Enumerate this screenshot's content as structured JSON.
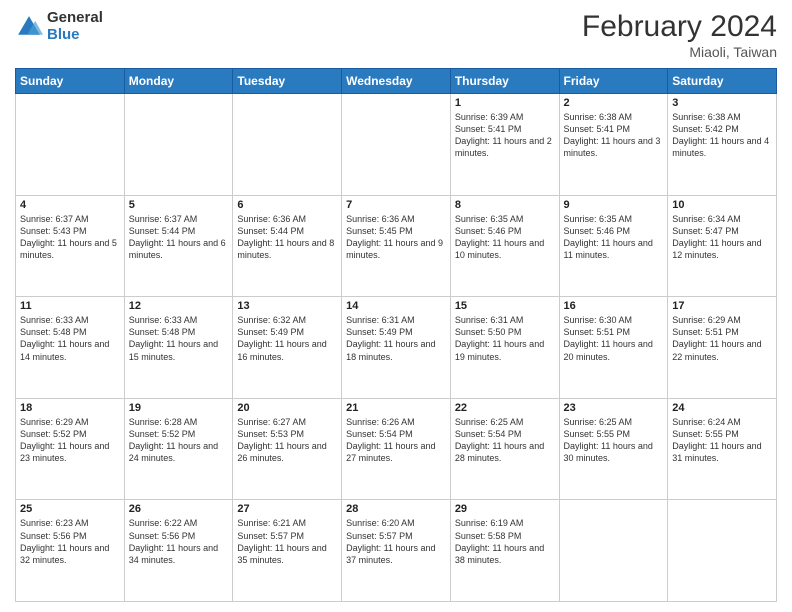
{
  "header": {
    "logo_line1": "General",
    "logo_line2": "Blue",
    "month_year": "February 2024",
    "location": "Miaoli, Taiwan"
  },
  "days_of_week": [
    "Sunday",
    "Monday",
    "Tuesday",
    "Wednesday",
    "Thursday",
    "Friday",
    "Saturday"
  ],
  "weeks": [
    [
      {
        "day": "",
        "info": ""
      },
      {
        "day": "",
        "info": ""
      },
      {
        "day": "",
        "info": ""
      },
      {
        "day": "",
        "info": ""
      },
      {
        "day": "1",
        "info": "Sunrise: 6:39 AM\nSunset: 5:41 PM\nDaylight: 11 hours and 2 minutes."
      },
      {
        "day": "2",
        "info": "Sunrise: 6:38 AM\nSunset: 5:41 PM\nDaylight: 11 hours and 3 minutes."
      },
      {
        "day": "3",
        "info": "Sunrise: 6:38 AM\nSunset: 5:42 PM\nDaylight: 11 hours and 4 minutes."
      }
    ],
    [
      {
        "day": "4",
        "info": "Sunrise: 6:37 AM\nSunset: 5:43 PM\nDaylight: 11 hours and 5 minutes."
      },
      {
        "day": "5",
        "info": "Sunrise: 6:37 AM\nSunset: 5:44 PM\nDaylight: 11 hours and 6 minutes."
      },
      {
        "day": "6",
        "info": "Sunrise: 6:36 AM\nSunset: 5:44 PM\nDaylight: 11 hours and 8 minutes."
      },
      {
        "day": "7",
        "info": "Sunrise: 6:36 AM\nSunset: 5:45 PM\nDaylight: 11 hours and 9 minutes."
      },
      {
        "day": "8",
        "info": "Sunrise: 6:35 AM\nSunset: 5:46 PM\nDaylight: 11 hours and 10 minutes."
      },
      {
        "day": "9",
        "info": "Sunrise: 6:35 AM\nSunset: 5:46 PM\nDaylight: 11 hours and 11 minutes."
      },
      {
        "day": "10",
        "info": "Sunrise: 6:34 AM\nSunset: 5:47 PM\nDaylight: 11 hours and 12 minutes."
      }
    ],
    [
      {
        "day": "11",
        "info": "Sunrise: 6:33 AM\nSunset: 5:48 PM\nDaylight: 11 hours and 14 minutes."
      },
      {
        "day": "12",
        "info": "Sunrise: 6:33 AM\nSunset: 5:48 PM\nDaylight: 11 hours and 15 minutes."
      },
      {
        "day": "13",
        "info": "Sunrise: 6:32 AM\nSunset: 5:49 PM\nDaylight: 11 hours and 16 minutes."
      },
      {
        "day": "14",
        "info": "Sunrise: 6:31 AM\nSunset: 5:49 PM\nDaylight: 11 hours and 18 minutes."
      },
      {
        "day": "15",
        "info": "Sunrise: 6:31 AM\nSunset: 5:50 PM\nDaylight: 11 hours and 19 minutes."
      },
      {
        "day": "16",
        "info": "Sunrise: 6:30 AM\nSunset: 5:51 PM\nDaylight: 11 hours and 20 minutes."
      },
      {
        "day": "17",
        "info": "Sunrise: 6:29 AM\nSunset: 5:51 PM\nDaylight: 11 hours and 22 minutes."
      }
    ],
    [
      {
        "day": "18",
        "info": "Sunrise: 6:29 AM\nSunset: 5:52 PM\nDaylight: 11 hours and 23 minutes."
      },
      {
        "day": "19",
        "info": "Sunrise: 6:28 AM\nSunset: 5:52 PM\nDaylight: 11 hours and 24 minutes."
      },
      {
        "day": "20",
        "info": "Sunrise: 6:27 AM\nSunset: 5:53 PM\nDaylight: 11 hours and 26 minutes."
      },
      {
        "day": "21",
        "info": "Sunrise: 6:26 AM\nSunset: 5:54 PM\nDaylight: 11 hours and 27 minutes."
      },
      {
        "day": "22",
        "info": "Sunrise: 6:25 AM\nSunset: 5:54 PM\nDaylight: 11 hours and 28 minutes."
      },
      {
        "day": "23",
        "info": "Sunrise: 6:25 AM\nSunset: 5:55 PM\nDaylight: 11 hours and 30 minutes."
      },
      {
        "day": "24",
        "info": "Sunrise: 6:24 AM\nSunset: 5:55 PM\nDaylight: 11 hours and 31 minutes."
      }
    ],
    [
      {
        "day": "25",
        "info": "Sunrise: 6:23 AM\nSunset: 5:56 PM\nDaylight: 11 hours and 32 minutes."
      },
      {
        "day": "26",
        "info": "Sunrise: 6:22 AM\nSunset: 5:56 PM\nDaylight: 11 hours and 34 minutes."
      },
      {
        "day": "27",
        "info": "Sunrise: 6:21 AM\nSunset: 5:57 PM\nDaylight: 11 hours and 35 minutes."
      },
      {
        "day": "28",
        "info": "Sunrise: 6:20 AM\nSunset: 5:57 PM\nDaylight: 11 hours and 37 minutes."
      },
      {
        "day": "29",
        "info": "Sunrise: 6:19 AM\nSunset: 5:58 PM\nDaylight: 11 hours and 38 minutes."
      },
      {
        "day": "",
        "info": ""
      },
      {
        "day": "",
        "info": ""
      }
    ]
  ]
}
